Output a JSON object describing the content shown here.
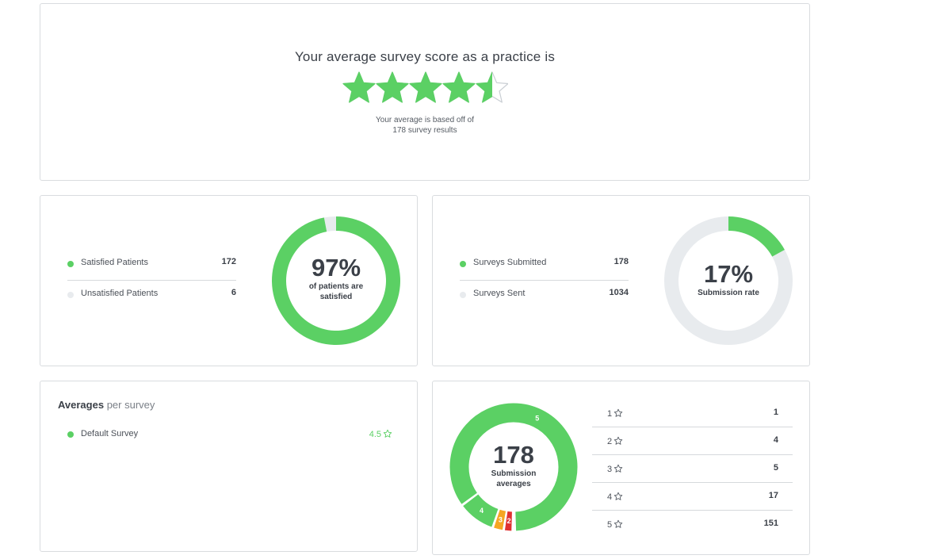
{
  "score_card": {
    "title": "Your average survey score as a practice is",
    "rating": 4.5,
    "max_rating": 5,
    "note_line1": "Your average is based off of",
    "note_line2": "178 survey results",
    "star_color": "#5bd064"
  },
  "satisfaction": {
    "legend": [
      {
        "label": "Satisfied Patients",
        "value": "172",
        "color": "#5bd064"
      },
      {
        "label": "Unsatisfied Patients",
        "value": "6",
        "color": "#e8ebee"
      }
    ],
    "percent_label": "97%",
    "percent": 0.97,
    "caption_line1": "of patients are",
    "caption_line2": "satisfied"
  },
  "submissions": {
    "legend": [
      {
        "label": "Surveys Submitted",
        "value": "178",
        "color": "#5bd064"
      },
      {
        "label": "Surveys Sent",
        "value": "1034",
        "color": "#e8ebee"
      }
    ],
    "percent_label": "17%",
    "percent": 0.17,
    "caption": "Submission rate"
  },
  "averages": {
    "title_bold": "Averages",
    "title_rest": "per survey",
    "surveys": [
      {
        "name": "Default Survey",
        "score": "4.5"
      }
    ]
  },
  "distribution": {
    "total": "178",
    "caption_line1": "Submission",
    "caption_line2": "averages",
    "rows": [
      {
        "rating": "1",
        "count": "1"
      },
      {
        "rating": "2",
        "count": "4"
      },
      {
        "rating": "3",
        "count": "5"
      },
      {
        "rating": "4",
        "count": "17"
      },
      {
        "rating": "5",
        "count": "151"
      }
    ],
    "segments": [
      {
        "label": "5",
        "value": 151,
        "color": "#5bd064"
      },
      {
        "label": "4",
        "value": 17,
        "color": "#5bd064"
      },
      {
        "label": "3",
        "value": 5,
        "color": "#f5a623"
      },
      {
        "label": "2",
        "value": 4,
        "color": "#e03131"
      },
      {
        "label": "",
        "value": 1,
        "color": "#e03131"
      }
    ]
  }
}
